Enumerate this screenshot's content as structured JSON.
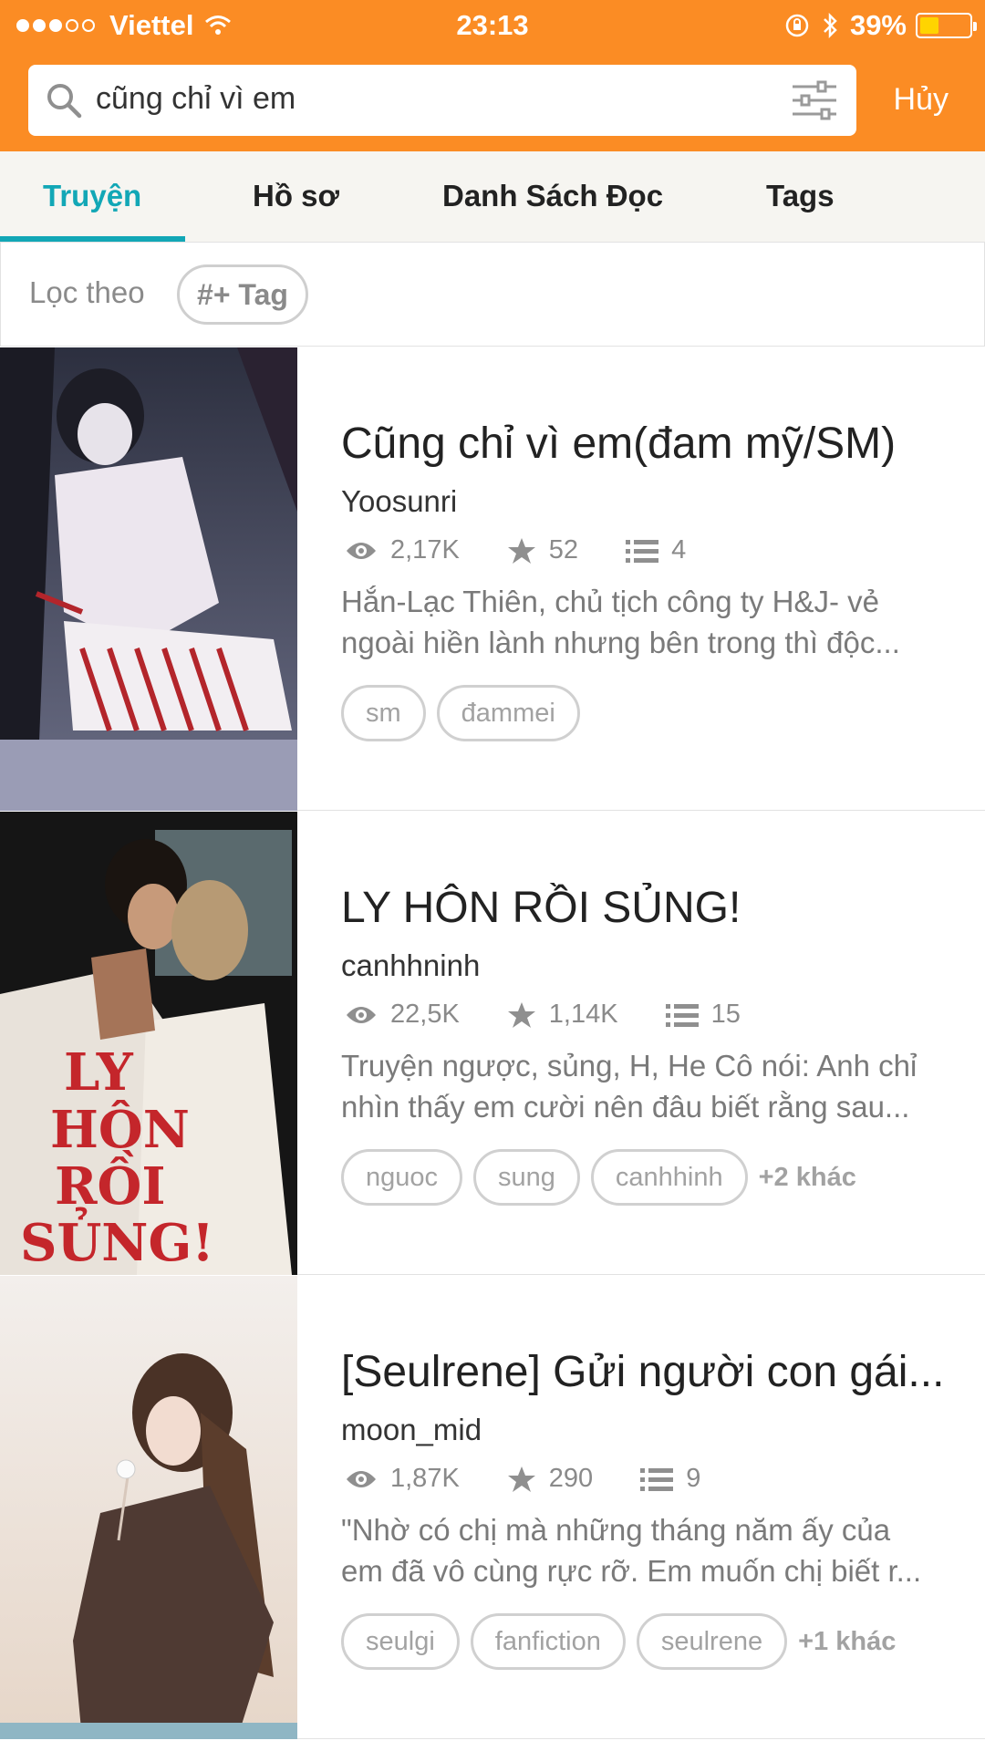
{
  "status_bar": {
    "carrier": "Viettel",
    "time": "23:13",
    "battery": "39%",
    "battery_level": 0.39
  },
  "search": {
    "query": "cũng chỉ vì em",
    "cancel_label": "Hủy"
  },
  "tabs": [
    {
      "label": "Truyện",
      "active": true
    },
    {
      "label": "Hồ sơ",
      "active": false
    },
    {
      "label": "Danh Sách Đọc",
      "active": false
    },
    {
      "label": "Tags",
      "active": false
    }
  ],
  "filter": {
    "label": "Lọc theo",
    "tag_button": "#+ Tag"
  },
  "colors": {
    "header": "#fb8c24",
    "accent": "#12a7b6"
  },
  "stories": [
    {
      "title": "Cũng chỉ vì em(đam mỹ/SM)",
      "author": "Yoosunri",
      "reads": "2,17K",
      "votes": "52",
      "parts": "4",
      "desc_line1": "Hắn-Lạc Thiên, chủ tịch công ty H&J- vẻ",
      "desc_line2": "ngoài hiền lành nhưng bên trong thì độc...",
      "tags": [
        "sm",
        "đammei"
      ],
      "more_tags": ""
    },
    {
      "title": "LY HÔN RỒI SỦNG!",
      "author": "canhhninh",
      "reads": "22,5K",
      "votes": "1,14K",
      "parts": "15",
      "desc_line1": "Truyện ngược, sủng, H, He Cô nói: Anh chỉ",
      "desc_line2": "nhìn thấy em cười nên đâu biết rằng sau...",
      "tags": [
        "nguoc",
        "sung",
        "canhhinh"
      ],
      "more_tags": "+2 khác",
      "cover_text": [
        "LY",
        "HÔN",
        "RỒI",
        "SỦNG!"
      ]
    },
    {
      "title": "[Seulrene] Gửi người con gái...",
      "author": "moon_mid",
      "reads": "1,87K",
      "votes": "290",
      "parts": "9",
      "desc_line1": "\"Nhờ có chị mà những tháng năm ấy của",
      "desc_line2": "em đã vô cùng rực rỡ. Em muốn chị biết r...",
      "tags": [
        "seulgi",
        "fanfiction",
        "seulrene"
      ],
      "more_tags": "+1 khác"
    }
  ]
}
